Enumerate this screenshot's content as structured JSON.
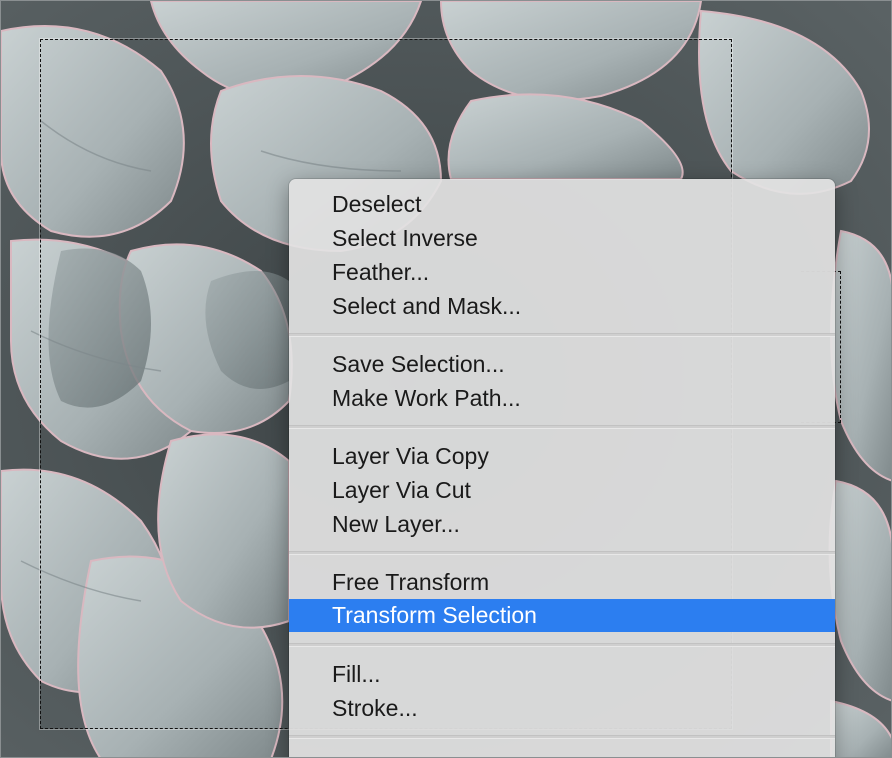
{
  "canvas": {
    "image_subject": "succulent rosette photo",
    "selection": "marquee-selection"
  },
  "context_menu": {
    "groups": [
      {
        "items": [
          {
            "label": "Deselect"
          },
          {
            "label": "Select Inverse"
          },
          {
            "label": "Feather..."
          },
          {
            "label": "Select and Mask..."
          }
        ]
      },
      {
        "items": [
          {
            "label": "Save Selection..."
          },
          {
            "label": "Make Work Path..."
          }
        ]
      },
      {
        "items": [
          {
            "label": "Layer Via Copy"
          },
          {
            "label": "Layer Via Cut"
          },
          {
            "label": "New Layer..."
          }
        ]
      },
      {
        "items": [
          {
            "label": "Free Transform"
          },
          {
            "label": "Transform Selection",
            "highlighted": true
          }
        ]
      },
      {
        "items": [
          {
            "label": "Fill..."
          },
          {
            "label": "Stroke..."
          }
        ]
      }
    ],
    "highlight_color": "#2c7ef0"
  }
}
